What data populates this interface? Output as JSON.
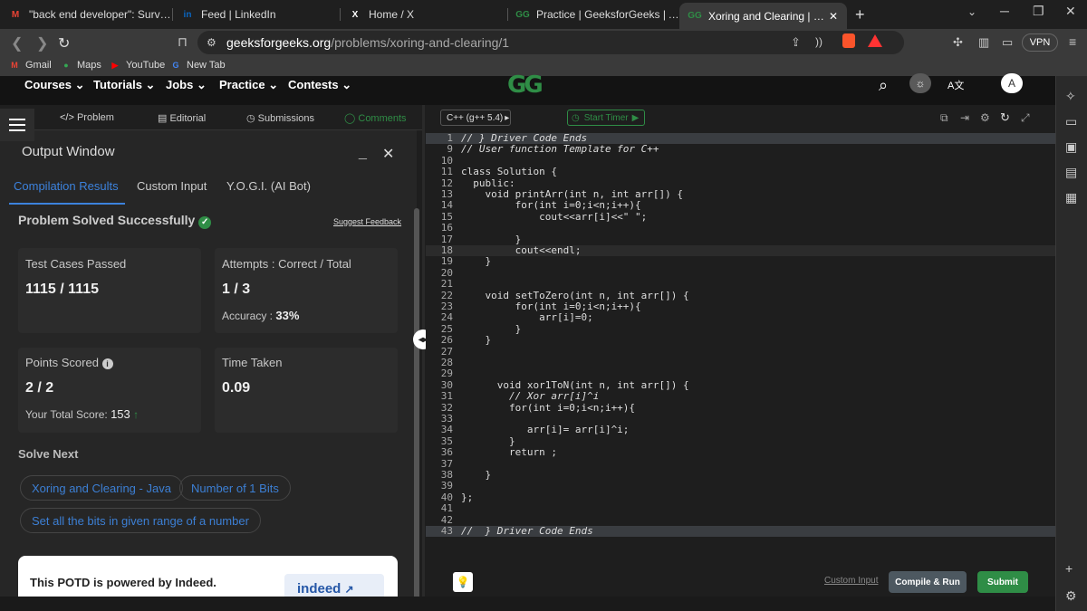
{
  "browser": {
    "tabs": [
      {
        "label": "\"back end developer\": SurveySparrow",
        "icon": "gmail-icon",
        "icon_text": "M",
        "icon_color": "#ea4335"
      },
      {
        "label": "Feed | LinkedIn",
        "icon": "linkedin-icon",
        "icon_text": "in",
        "icon_color": "#0a66c2"
      },
      {
        "label": "Home / X",
        "icon": "x-icon",
        "icon_text": "X",
        "icon_color": "#ffffff"
      },
      {
        "label": "Practice | GeeksforGeeks | A computer",
        "icon": "gfg-icon",
        "icon_text": "GG",
        "icon_color": "#2f8d46"
      },
      {
        "label": "Xoring and Clearing | Practice | G",
        "icon": "gfg-icon",
        "icon_text": "GG",
        "icon_color": "#2f8d46"
      }
    ],
    "url_domain": "geeksforgeeks.org",
    "url_path": "/problems/xoring-and-clearing/1",
    "vpn_label": "VPN",
    "bookmarks": [
      {
        "label": "Gmail",
        "icon": "gmail-icon",
        "icon_text": "M",
        "color": "#ea4335"
      },
      {
        "label": "Maps",
        "icon": "maps-icon",
        "icon_text": "●",
        "color": "#34a853"
      },
      {
        "label": "YouTube",
        "icon": "youtube-icon",
        "icon_text": "▶",
        "color": "#ff0000"
      },
      {
        "label": "New Tab",
        "icon": "google-icon",
        "icon_text": "G",
        "color": "#4285f4"
      }
    ]
  },
  "site_nav": {
    "items": [
      "Courses",
      "Tutorials",
      "Jobs",
      "Practice",
      "Contests"
    ],
    "avatar": "A"
  },
  "problem_tabs": [
    "Problem",
    "Editorial",
    "Submissions",
    "Comments"
  ],
  "output": {
    "title": "Output Window",
    "subtabs": [
      "Compilation Results",
      "Custom Input",
      "Y.O.G.I. (AI Bot)"
    ],
    "status": "Problem Solved Successfully",
    "suggest_feedback": "Suggest Feedback",
    "test_cases_label": "Test Cases Passed",
    "test_cases_value": "1115 / 1115",
    "attempts_label": "Attempts : Correct / Total",
    "attempts_value": "1 / 3",
    "accuracy_label": "Accuracy :",
    "accuracy_value": "33%",
    "points_label": "Points Scored",
    "points_value": "2 / 2",
    "total_score_label": "Your Total Score:",
    "total_score_value": "153",
    "time_label": "Time Taken",
    "time_value": "0.09",
    "solve_next_label": "Solve Next",
    "solve_next": [
      "Xoring and Clearing - Java",
      "Number of 1 Bits",
      "Set all the bits in given range of a number"
    ],
    "potd_text": "This POTD is powered by Indeed.",
    "indeed_label": "indeed"
  },
  "editor": {
    "language": "C++ (g++ 5.4)",
    "timer_label": "Start Timer",
    "custom_input": "Custom Input",
    "compile_run": "Compile & Run",
    "submit": "Submit",
    "lines": [
      {
        "n": "1",
        "t": "// } Driver Code Ends",
        "c": true
      },
      {
        "n": "9",
        "t": "// User function Template for C++",
        "c": true
      },
      {
        "n": "10",
        "t": ""
      },
      {
        "n": "11",
        "t": "class Solution {"
      },
      {
        "n": "12",
        "t": "  public:"
      },
      {
        "n": "13",
        "t": "    void printArr(int n, int arr[]) {"
      },
      {
        "n": "14",
        "t": "         for(int i=0;i<n;i++){"
      },
      {
        "n": "15",
        "t": "             cout<<arr[i]<<\" \";"
      },
      {
        "n": "16",
        "t": ""
      },
      {
        "n": "17",
        "t": "         }"
      },
      {
        "n": "18",
        "t": "         cout<<endl;"
      },
      {
        "n": "19",
        "t": "    }"
      },
      {
        "n": "20",
        "t": ""
      },
      {
        "n": "21",
        "t": ""
      },
      {
        "n": "22",
        "t": "    void setToZero(int n, int arr[]) {"
      },
      {
        "n": "23",
        "t": "         for(int i=0;i<n;i++){"
      },
      {
        "n": "24",
        "t": "             arr[i]=0;"
      },
      {
        "n": "25",
        "t": "         }"
      },
      {
        "n": "26",
        "t": "    }"
      },
      {
        "n": "27",
        "t": ""
      },
      {
        "n": "28",
        "t": ""
      },
      {
        "n": "29",
        "t": ""
      },
      {
        "n": "30",
        "t": "      void xor1ToN(int n, int arr[]) {"
      },
      {
        "n": "31",
        "t": "        // Xor arr[i]^i",
        "c": true
      },
      {
        "n": "32",
        "t": "        for(int i=0;i<n;i++){"
      },
      {
        "n": "33",
        "t": ""
      },
      {
        "n": "34",
        "t": "           arr[i]= arr[i]^i;"
      },
      {
        "n": "35",
        "t": "        }"
      },
      {
        "n": "36",
        "t": "        return ;"
      },
      {
        "n": "37",
        "t": ""
      },
      {
        "n": "38",
        "t": "    }"
      },
      {
        "n": "39",
        "t": ""
      },
      {
        "n": "40",
        "t": "};"
      },
      {
        "n": "41",
        "t": ""
      },
      {
        "n": "42",
        "t": ""
      },
      {
        "n": "43",
        "t": "//  } Driver Code Ends",
        "c": true
      }
    ]
  }
}
